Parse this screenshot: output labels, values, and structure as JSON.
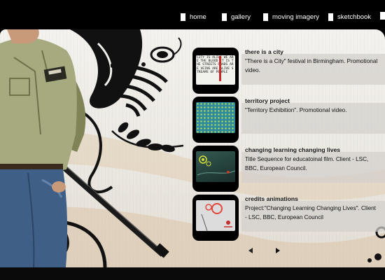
{
  "nav": [
    {
      "label": "home"
    },
    {
      "label": "gallery"
    },
    {
      "label": "moving imagery"
    },
    {
      "label": "sketchbook"
    }
  ],
  "items": [
    {
      "title": "there is a city",
      "description": "\"There is a City\" festival in Birmingham. Promotional video.",
      "thumb_text": "CITY IS ALIVE WE ARE THE BLOOD IT IS THE STREETS ROADS ARE VEINS ARE ALIVE STREAMS OF PEOPLE"
    },
    {
      "title": "territory project",
      "description": "\"Territory Exhibition\". Promotional video."
    },
    {
      "title": "changing learning changing lives",
      "description": "Title Sequence for educatoinal film. Client - LSC, BBC, European Council."
    },
    {
      "title": "credits animations",
      "description": "Project:\"Changing Learning Changing Lives\". Client - LSC, BBC, European Council"
    }
  ],
  "colors": {
    "background": "#000000",
    "panel": "#f1efea",
    "band": "#d2d0cc",
    "territory": "#2f8aa0",
    "learning": "#2a4a44"
  }
}
